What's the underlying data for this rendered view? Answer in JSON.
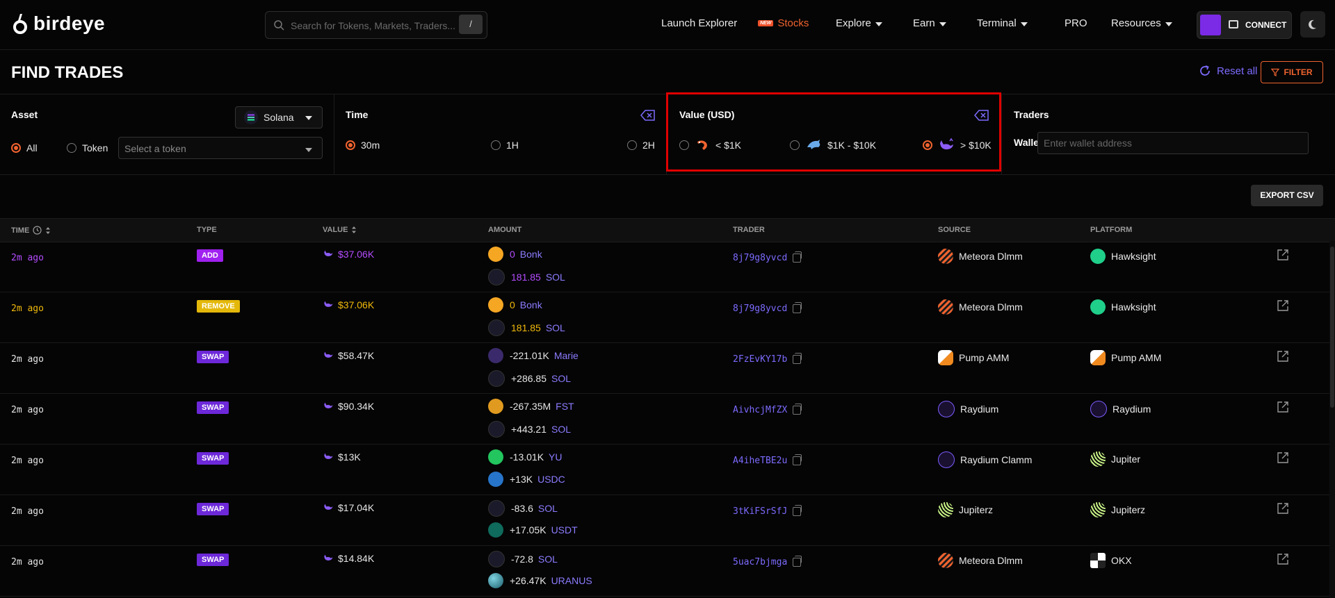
{
  "brand": {
    "name": "birdeye"
  },
  "search": {
    "placeholder": "Search for Tokens, Markets, Traders...",
    "shortcut": "/"
  },
  "nav": {
    "launch_explorer": "Launch Explorer",
    "new_badge": "NEW",
    "stocks": "Stocks",
    "explore": "Explore",
    "earn": "Earn",
    "terminal": "Terminal",
    "pro": "PRO",
    "resources": "Resources",
    "connect": "CONNECT"
  },
  "header": {
    "title": "FIND TRADES",
    "reset": "Reset all",
    "filter": "FILTER"
  },
  "filters": {
    "asset": {
      "title": "Asset",
      "chain": "Solana",
      "all_label": "All",
      "token_label": "Token",
      "token_placeholder": "Select a token",
      "selected": "All"
    },
    "time": {
      "title": "Time",
      "options": [
        "30m",
        "1H",
        "2H"
      ],
      "selected": "30m"
    },
    "value": {
      "title": "Value (USD)",
      "options": [
        "< $1K",
        "$1K - $10K",
        "> $10K"
      ],
      "selected": "> $10K"
    },
    "traders": {
      "title": "Traders",
      "wallet_label": "Wallet",
      "wallet_placeholder": "Enter wallet address"
    }
  },
  "export": "EXPORT CSV",
  "table": {
    "columns": [
      "TIME",
      "TYPE",
      "VALUE",
      "AMOUNT",
      "TRADER",
      "SOURCE",
      "PLATFORM"
    ],
    "rows": [
      {
        "time": "2m ago",
        "type": "ADD",
        "value": "$37.06K",
        "a1": "0",
        "a1_sym": "Bonk",
        "a2": "181.85",
        "a2_sym": "SOL",
        "trader": "8j79g8yvcd",
        "source": "Meteora Dlmm",
        "platform": "Hawksight"
      },
      {
        "time": "2m ago",
        "type": "REMOVE",
        "value": "$37.06K",
        "a1": "0",
        "a1_sym": "Bonk",
        "a2": "181.85",
        "a2_sym": "SOL",
        "trader": "8j79g8yvcd",
        "source": "Meteora Dlmm",
        "platform": "Hawksight"
      },
      {
        "time": "2m ago",
        "type": "SWAP",
        "value": "$58.47K",
        "a1": "-221.01K",
        "a1_sym": "Marie",
        "a2": "+286.85",
        "a2_sym": "SOL",
        "trader": "2FzEvKY17b",
        "source": "Pump AMM",
        "platform": "Pump AMM"
      },
      {
        "time": "2m ago",
        "type": "SWAP",
        "value": "$90.34K",
        "a1": "-267.35M",
        "a1_sym": "FST",
        "a2": "+443.21",
        "a2_sym": "SOL",
        "trader": "AivhcjMfZX",
        "source": "Raydium",
        "platform": "Raydium"
      },
      {
        "time": "2m ago",
        "type": "SWAP",
        "value": "$13K",
        "a1": "-13.01K",
        "a1_sym": "YU",
        "a2": "+13K",
        "a2_sym": "USDC",
        "trader": "A4iheTBE2u",
        "source": "Raydium Clamm",
        "platform": "Jupiter"
      },
      {
        "time": "2m ago",
        "type": "SWAP",
        "value": "$17.04K",
        "a1": "-83.6",
        "a1_sym": "SOL",
        "a2": "+17.05K",
        "a2_sym": "USDT",
        "trader": "3tKiFSrSfJ",
        "source": "Jupiterz",
        "platform": "Jupiterz"
      },
      {
        "time": "2m ago",
        "type": "SWAP",
        "value": "$14.84K",
        "a1": "-72.8",
        "a1_sym": "SOL",
        "a2": "+26.47K",
        "a2_sym": "URANUS",
        "trader": "5uac7bjmga",
        "source": "Meteora Dlmm",
        "platform": "OKX"
      }
    ]
  },
  "colors": {
    "accent": "#f0632f",
    "link": "#7c6bff",
    "add": "#a020f0",
    "remove": "#f0c010",
    "swap": "#6d28d9",
    "highlight": "#e00000"
  }
}
